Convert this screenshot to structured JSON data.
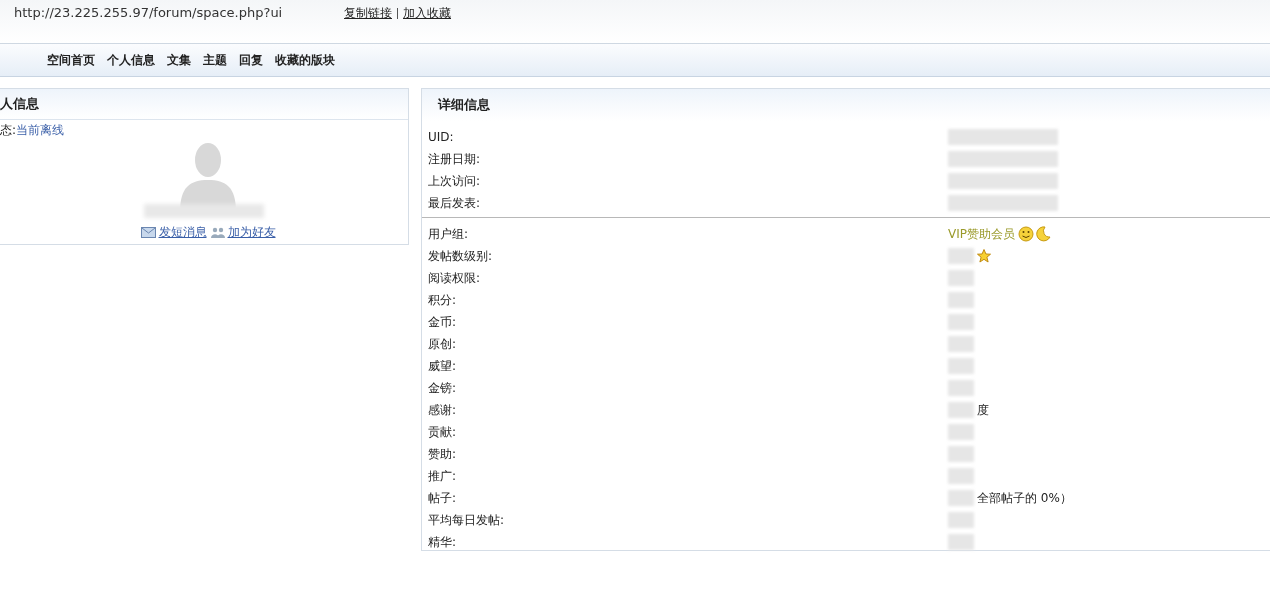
{
  "address_bar": {
    "url": "http://23.225.255.97/forum/space.php?ui",
    "links": [
      {
        "label": "复制链接"
      },
      {
        "label": "加入收藏"
      }
    ]
  },
  "nav": [
    {
      "label": "空间首页"
    },
    {
      "label": "个人信息"
    },
    {
      "label": "文集"
    },
    {
      "label": "主题"
    },
    {
      "label": "回复"
    },
    {
      "label": "收藏的版块"
    }
  ],
  "profile_panel": {
    "title": "人信息",
    "status_label": "态:",
    "status": "当前离线",
    "actions": [
      {
        "kind": "message",
        "label": "发短消息"
      },
      {
        "kind": "friend",
        "label": "加为好友"
      }
    ]
  },
  "details_panel": {
    "title": "详细信息",
    "groups": [
      [
        {
          "label": "UID:",
          "redacted": true
        },
        {
          "label": "注册日期:",
          "redacted": true
        },
        {
          "label": "上次访问:",
          "redacted": true
        },
        {
          "label": "最后发表:",
          "redacted": true
        }
      ],
      [
        {
          "label": "用户组:",
          "value": "VIP赞助会员",
          "kind": "group"
        },
        {
          "label": "发帖数级别:",
          "redacted": true,
          "kind": "star"
        },
        {
          "label": "阅读权限:",
          "redacted": true
        },
        {
          "label": "积分:",
          "redacted": true
        },
        {
          "label": "金币:",
          "redacted": true
        },
        {
          "label": "原创:",
          "redacted": true
        },
        {
          "label": "威望:",
          "redacted": true
        },
        {
          "label": "金镑:",
          "redacted": true
        },
        {
          "label": "感谢:",
          "redacted": true,
          "value": "度"
        },
        {
          "label": "贡献:",
          "redacted": true
        },
        {
          "label": "赞助:",
          "redacted": true
        },
        {
          "label": "推广:",
          "redacted": true
        },
        {
          "label": "帖子:",
          "redacted": true,
          "value": "全部帖子的 0%）"
        },
        {
          "label": "平均每日发帖:",
          "redacted": true
        },
        {
          "label": "精华:",
          "redacted": true
        }
      ]
    ]
  }
}
